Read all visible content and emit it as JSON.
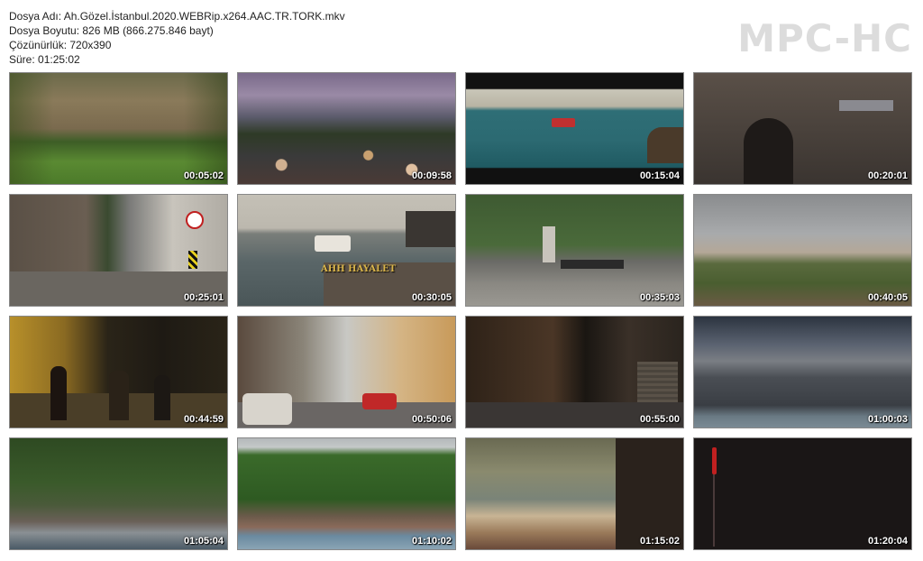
{
  "file_info": {
    "name_line": "Dosya Adı: Ah.Gözel.İstanbul.2020.WEBRip.x264.AAC.TR.TORK.mkv",
    "size_line": "Dosya Boyutu: 826 MB (866.275.846 bayt)",
    "resolution_line": "Çözünürlük: 720x390",
    "duration_line": "Süre: 01:25:02"
  },
  "logo": "MPC-HC",
  "thumbnails": [
    {
      "time": "00:05:02",
      "scene": "ruins-field"
    },
    {
      "time": "00:09:58",
      "scene": "crowd-dusk"
    },
    {
      "time": "00:15:04",
      "scene": "boat-sea"
    },
    {
      "time": "00:20:01",
      "scene": "stone-arch"
    },
    {
      "time": "00:25:01",
      "scene": "street-wall"
    },
    {
      "time": "00:30:05",
      "scene": "ferry-pier",
      "caption": "AHH HAYALET"
    },
    {
      "time": "00:35:03",
      "scene": "courtyard"
    },
    {
      "time": "00:40:05",
      "scene": "city-panorama"
    },
    {
      "time": "00:44:59",
      "scene": "night-street"
    },
    {
      "time": "00:50:06",
      "scene": "alley-car"
    },
    {
      "time": "00:55:00",
      "scene": "night-shops"
    },
    {
      "time": "01:00:03",
      "scene": "city-skyline"
    },
    {
      "time": "01:05:04",
      "scene": "seaside-park"
    },
    {
      "time": "01:10:02",
      "scene": "bosphorus-village"
    },
    {
      "time": "01:15:02",
      "scene": "painting"
    },
    {
      "time": "01:20:04",
      "scene": "dark-frame"
    }
  ]
}
